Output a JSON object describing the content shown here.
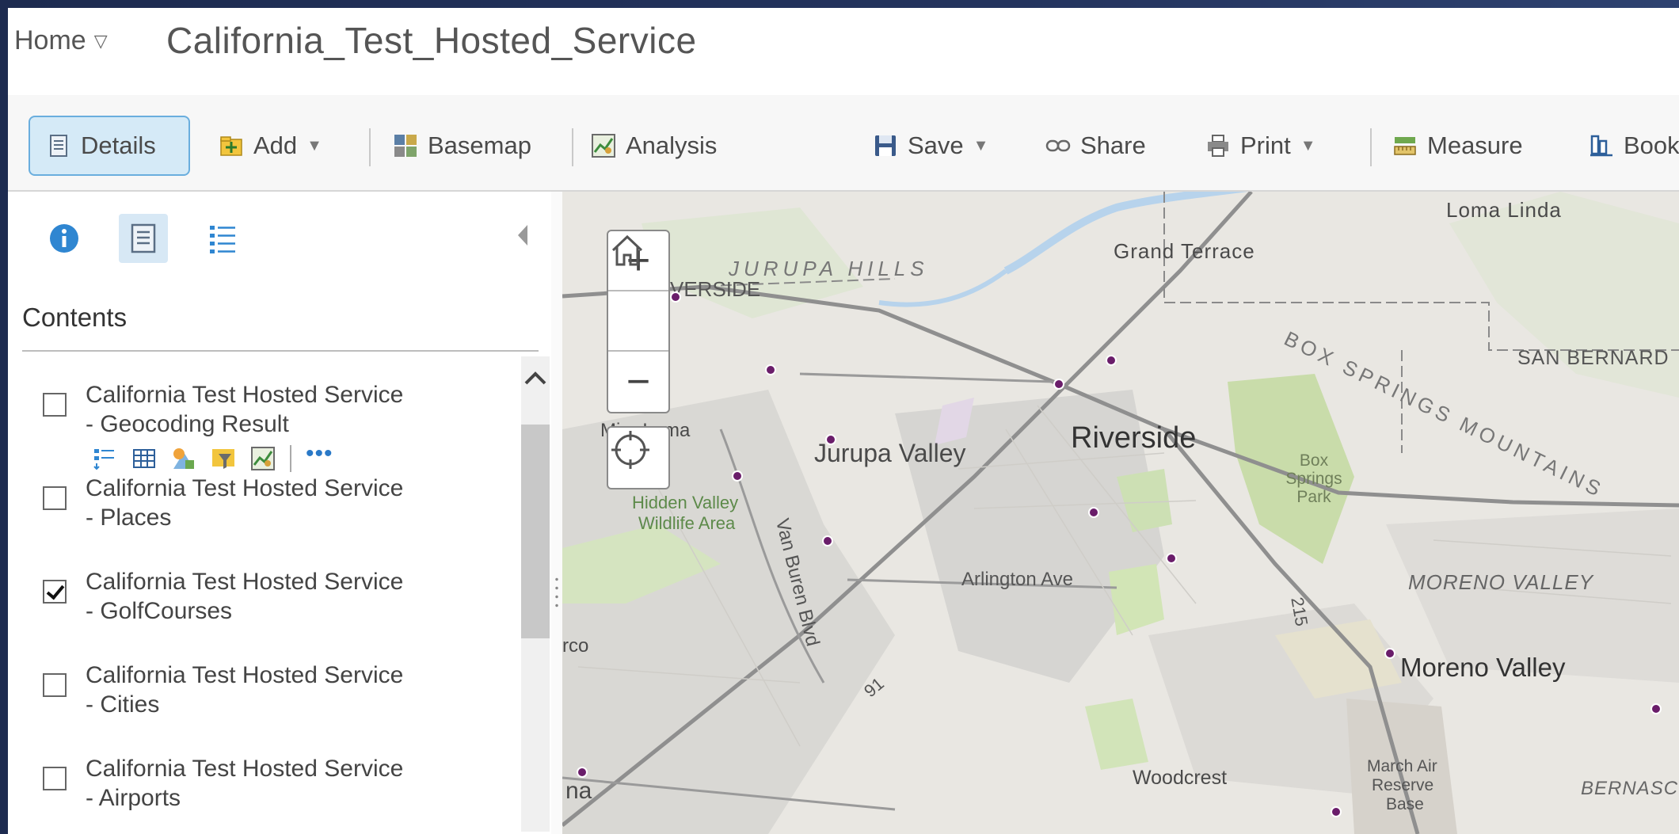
{
  "header": {
    "home_label": "Home",
    "home_caret": "▽",
    "title": "California_Test_Hosted_Service"
  },
  "toolbar": {
    "details": "Details",
    "add": "Add",
    "basemap": "Basemap",
    "analysis": "Analysis",
    "save": "Save",
    "share": "Share",
    "print": "Print",
    "measure": "Measure",
    "bookmarks": "Book",
    "caret": "▼"
  },
  "panel": {
    "contents_title": "Contents",
    "more_label": "•••",
    "layers": [
      {
        "line1": "California Test Hosted Service",
        "line2": "- Geocoding Result",
        "checked": false
      },
      {
        "line1": "California Test Hosted Service",
        "line2": "- Places",
        "checked": false
      },
      {
        "line1": "California Test Hosted Service",
        "line2": "- GolfCourses",
        "checked": true
      },
      {
        "line1": "California Test Hosted Service",
        "line2": "- Cities",
        "checked": false
      },
      {
        "line1": "California Test Hosted Service",
        "line2": "- Airports",
        "checked": false
      }
    ]
  },
  "map": {
    "labels": {
      "loma_linda": "Loma Linda",
      "grand_terrace": "Grand Terrace",
      "jurupa_hills": "JURUPA HILLS",
      "riverside_partial": "VERSIDE",
      "san_bernardino": "SAN BERNARD",
      "box_springs_mountains": "BOX SPRINGS MOUNTAINS",
      "mira_loma": "Mira Loma",
      "jurupa_valley": "Jurupa Valley",
      "riverside": "Riverside",
      "box_springs_park": "Box Springs Park",
      "hidden_valley": "Hidden Valley",
      "wildlife_area": "Wildlife Area",
      "van_buren": "Van Buren Blvd",
      "arlington": "Arlington Ave",
      "moreno_valley_area": "MORENO VALLEY",
      "moreno_valley": "Moreno Valley",
      "corona_partial": "rco",
      "route_215": "215",
      "route_91": "91",
      "woodcrest": "Woodcrest",
      "march_air": "March Air",
      "reserve": "Reserve",
      "base": "Base",
      "na_partial": "na",
      "bernasconi": "BERNASCO"
    },
    "zoom_in": "+",
    "zoom_out": "−",
    "point_color": "#6a1d6a"
  }
}
